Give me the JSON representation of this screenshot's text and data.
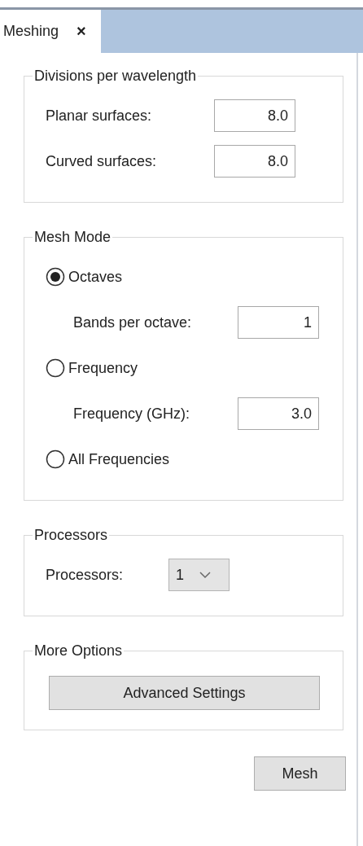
{
  "tabs": [
    {
      "label": "Meshing",
      "close": "×",
      "selected": true
    }
  ],
  "groups": [
    {
      "title": "Divisions per wavelength",
      "rows": [
        {
          "kind": "field",
          "label": "Planar surfaces:",
          "value": "8.0"
        },
        {
          "kind": "field",
          "label": "Curved surfaces:",
          "value": "8.0"
        }
      ]
    },
    {
      "title": "Mesh Mode",
      "rows": [
        {
          "kind": "radio",
          "label": "Octaves",
          "selected": true
        },
        {
          "kind": "subfield",
          "label": "Bands per octave:",
          "value": "1"
        },
        {
          "kind": "radio",
          "label": "Frequency",
          "selected": false
        },
        {
          "kind": "subfield",
          "label": "Frequency (GHz):",
          "value": "3.0"
        },
        {
          "kind": "radio",
          "label": "All Frequencies",
          "selected": false
        }
      ]
    },
    {
      "title": "Processors",
      "rows": [
        {
          "kind": "dropdown",
          "label": "Processors:",
          "value": "1"
        }
      ]
    },
    {
      "title": "More Options",
      "rows": [
        {
          "kind": "button",
          "label": "Advanced Settings"
        }
      ]
    }
  ],
  "buttons": [
    "Mesh"
  ]
}
